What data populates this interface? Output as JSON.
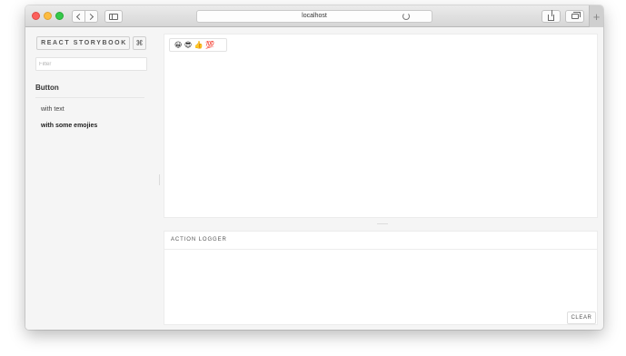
{
  "browser": {
    "address": "localhost",
    "new_tab_label": "+"
  },
  "sidebar": {
    "brand_label": "REACT STORYBOOK",
    "shortcut_label": "⌘",
    "filter": {
      "placeholder": "Filter",
      "value": ""
    },
    "kind": "Button",
    "stories": [
      {
        "label": "with text",
        "selected": false
      },
      {
        "label": "with some emojies",
        "selected": true
      }
    ]
  },
  "preview": {
    "button_label": "😀 😎 👍 💯"
  },
  "action_logger": {
    "title": "ACTION LOGGER",
    "clear_label": "CLEAR"
  }
}
